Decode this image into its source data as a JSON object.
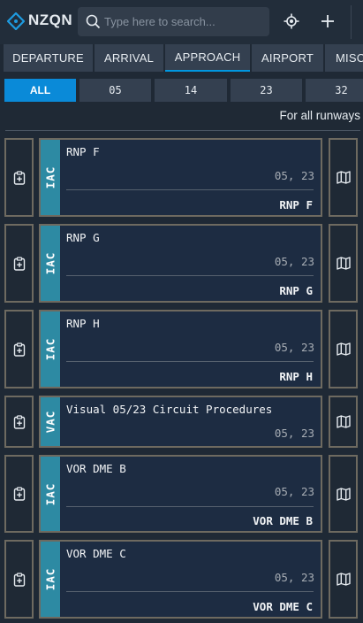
{
  "header": {
    "airport_code": "NZQN",
    "search_placeholder": "Type here to search...",
    "icons": [
      "logo-icon",
      "search-icon",
      "crosshair-icon",
      "plus-icon"
    ]
  },
  "category_tabs": [
    {
      "label": "DEPARTURE",
      "active": false
    },
    {
      "label": "ARRIVAL",
      "active": false
    },
    {
      "label": "APPROACH",
      "active": true
    },
    {
      "label": "AIRPORT",
      "active": false
    },
    {
      "label": "MISC",
      "active": false
    }
  ],
  "runway_filters": [
    {
      "label": "ALL",
      "active": true
    },
    {
      "label": "05",
      "active": false
    },
    {
      "label": "14",
      "active": false
    },
    {
      "label": "23",
      "active": false
    },
    {
      "label": "32",
      "active": false
    }
  ],
  "runway_note": "For all runways",
  "charts": [
    {
      "type": "IAC",
      "title": "RNP F",
      "runways": "05, 23",
      "ident": "RNP F"
    },
    {
      "type": "IAC",
      "title": "RNP G",
      "runways": "05, 23",
      "ident": "RNP G"
    },
    {
      "type": "IAC",
      "title": "RNP H",
      "runways": "05, 23",
      "ident": "RNP H"
    },
    {
      "type": "VAC",
      "title": "Visual 05/23 Circuit Procedures",
      "runways": "05, 23",
      "ident": ""
    },
    {
      "type": "IAC",
      "title": "VOR DME B",
      "runways": "05, 23",
      "ident": "VOR DME B"
    },
    {
      "type": "IAC",
      "title": "VOR DME C",
      "runways": "05, 23",
      "ident": "VOR DME C"
    }
  ],
  "colors": {
    "accent": "#0a8ad8",
    "badge": "#2d8aa3",
    "card_bg": "#1d2c42",
    "card_border": "#6e6a60",
    "background": "#1f2935"
  }
}
